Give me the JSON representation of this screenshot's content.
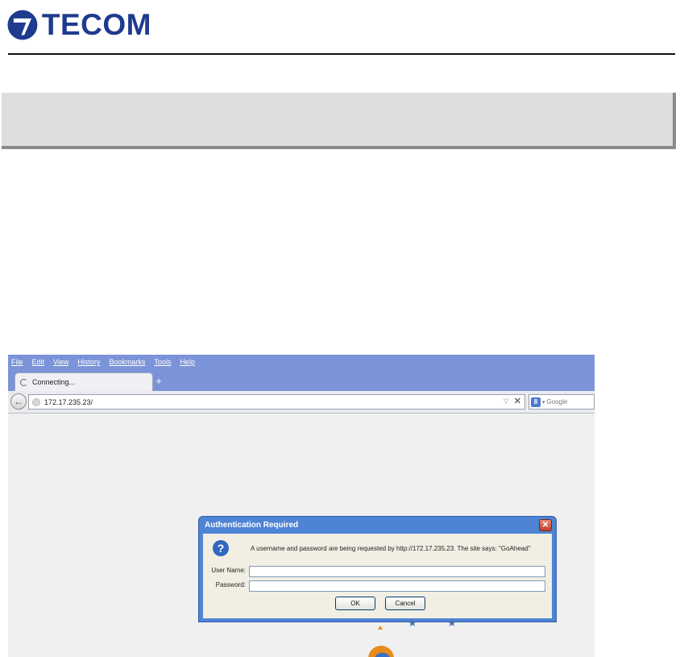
{
  "document": {
    "logo_text": "TECOM"
  },
  "browser": {
    "menu": [
      "File",
      "Edit",
      "View",
      "History",
      "Bookmarks",
      "Tools",
      "Help"
    ],
    "tab": {
      "title": "Connecting..."
    },
    "new_tab_symbol": "+",
    "url": "172.17.235.23/",
    "search": {
      "placeholder": "Google",
      "engine_icon": "google-icon"
    }
  },
  "dialog": {
    "title": "Authentication Required",
    "close_symbol": "✕",
    "message": "A username and password are being requested by http://172.17.235.23. The site says: \"GoAhead\"",
    "username_label": "User Name:",
    "username_value": "",
    "password_label": "Password:",
    "password_value": "",
    "ok_label": "OK",
    "cancel_label": "Cancel"
  },
  "colors": {
    "brand": "#1f3b8f",
    "chrome": "#7b93d8",
    "dialog_frame": "#4f84d5"
  }
}
